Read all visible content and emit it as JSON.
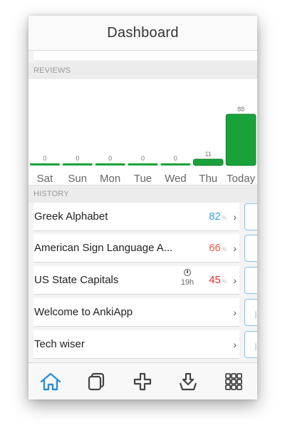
{
  "header": {
    "title": "Dashboard"
  },
  "sections": {
    "reviews": "REVIEWS",
    "history": "HISTORY"
  },
  "chart_data": {
    "type": "bar",
    "categories": [
      "Sat",
      "Sun",
      "Mon",
      "Tue",
      "Wed",
      "Thu",
      "Today"
    ],
    "values": [
      0,
      0,
      0,
      0,
      0,
      11,
      88
    ],
    "ylim": [
      0,
      88
    ],
    "bar_color": "#1aa23a"
  },
  "history": [
    {
      "name": "Greek Alphabet",
      "score": "82",
      "score_color": "#3aa6e0",
      "timer": ""
    },
    {
      "name": "American Sign Language A...",
      "score": "66",
      "score_color": "#f05a4a",
      "timer": ""
    },
    {
      "name": "US State Capitals",
      "score": "45",
      "score_color": "#e23030",
      "timer": "19h"
    },
    {
      "name": "Welcome to AnkiApp",
      "score": "",
      "score_color": "",
      "timer": ""
    },
    {
      "name": "Tech wiser",
      "score": "",
      "score_color": "",
      "timer": ""
    }
  ],
  "tabs": [
    {
      "icon": "home-icon",
      "active": true
    },
    {
      "icon": "decks-icon",
      "active": false
    },
    {
      "icon": "add-icon",
      "active": false
    },
    {
      "icon": "download-icon",
      "active": false
    },
    {
      "icon": "grid-icon",
      "active": false
    }
  ],
  "colors": {
    "accent": "#2b8fd6",
    "tab_inactive": "#444444"
  }
}
